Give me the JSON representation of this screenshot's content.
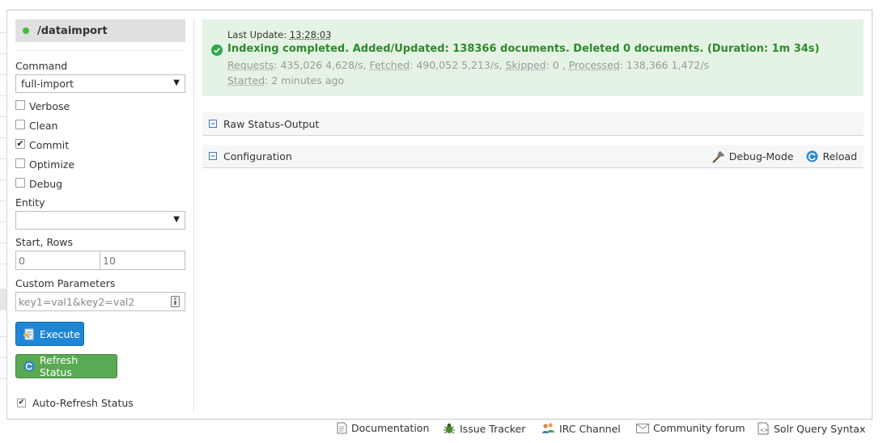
{
  "handler": {
    "name": "/dataimport",
    "status_color": "#3ebd3e"
  },
  "form": {
    "command_label": "Command",
    "command_value": "full-import",
    "options": [
      {
        "label": "Verbose",
        "checked": false
      },
      {
        "label": "Clean",
        "checked": false
      },
      {
        "label": "Commit",
        "checked": true
      },
      {
        "label": "Optimize",
        "checked": false
      },
      {
        "label": "Debug",
        "checked": false
      }
    ],
    "check_mark": "✔",
    "entity_label": "Entity",
    "entity_value": "",
    "start_rows_label": "Start, Rows",
    "start_value": "0",
    "rows_value": "10",
    "custom_params_label": "Custom Parameters",
    "custom_params_placeholder": "key1=val1&key2=val2",
    "execute_label": "Execute",
    "refresh_label": "Refresh Status",
    "auto_refresh_label": "Auto-Refresh Status",
    "auto_refresh_checked": true
  },
  "status": {
    "last_update_label": "Last Update:",
    "last_update_time": "13:28:03",
    "message": "Indexing completed. Added/Updated: 138366 documents. Deleted 0 documents. (Duration: 1m 34s)",
    "requests_label": "Requests",
    "requests_value": ": 435,026 4,628/s, ",
    "fetched_label": "Fetched",
    "fetched_value": ": 490,052 5,213/s, ",
    "skipped_label": "Skipped",
    "skipped_value": ": 0 , ",
    "processed_label": "Processed",
    "processed_value": ": 138,366 1,472/s",
    "started_label": "Started",
    "started_value": ": 2 minutes ago",
    "success_color": "#2d8a2d",
    "background": "#e5f3e5"
  },
  "sections": {
    "raw_status": "Raw Status-Output",
    "configuration": "Configuration",
    "debug_mode": "Debug-Mode",
    "reload": "Reload"
  },
  "footer": {
    "documentation": "Documentation",
    "issue_tracker": "Issue Tracker",
    "irc_channel": "IRC Channel",
    "community_forum": "Community forum",
    "solr_query_syntax": "Solr Query Syntax"
  },
  "icons": [
    "status-dot",
    "dropdown-caret",
    "checkbox",
    "param-help-icon",
    "execute-icon",
    "refresh-icon",
    "success-check-icon",
    "collapse-toggle-icon",
    "hammer-icon",
    "reload-icon",
    "document-icon",
    "bug-icon",
    "people-icon",
    "envelope-icon",
    "syntax-doc-icon"
  ]
}
